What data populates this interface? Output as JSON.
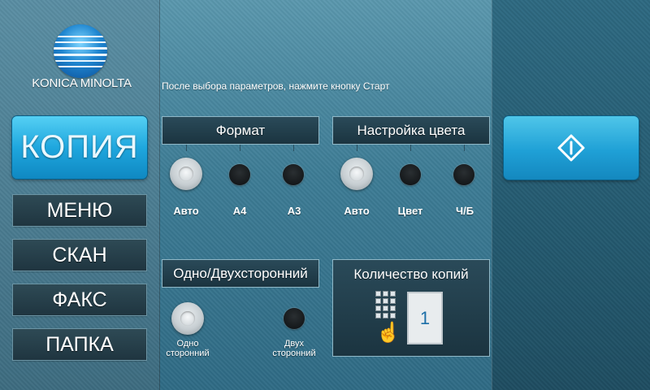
{
  "brand": {
    "name": "KONICA MINOLTA"
  },
  "hint": "После выбора параметров, нажмите кнопку Старт",
  "sidebar": {
    "active": "КОПИЯ",
    "items": [
      {
        "label": "МЕНЮ"
      },
      {
        "label": "СКАН"
      },
      {
        "label": "ФАКС"
      },
      {
        "label": "ПАПКА"
      }
    ]
  },
  "format": {
    "title": "Формат",
    "options": [
      "Авто",
      "A4",
      "A3"
    ],
    "selected": "Авто"
  },
  "color": {
    "title": "Настройка цвета",
    "options": [
      "Авто",
      "Цвет",
      "Ч/Б"
    ],
    "selected": "Авто"
  },
  "duplex": {
    "title": "Одно/Двухсторонний",
    "options": [
      {
        "line1": "Одно",
        "line2": "сторонний"
      },
      {
        "line1": "Двух",
        "line2": "сторонний"
      }
    ],
    "selected": "Одно сторонний"
  },
  "copies": {
    "title": "Количество копий",
    "count": "1"
  },
  "start": {
    "icon": "start-icon"
  },
  "icons": [
    "logo-globe-icon",
    "keypad-icon",
    "hand-pointer-icon",
    "start-icon"
  ],
  "colors": {
    "accent": "#1fa7de",
    "panel": "#1b3440",
    "background": "#3f7f98"
  }
}
